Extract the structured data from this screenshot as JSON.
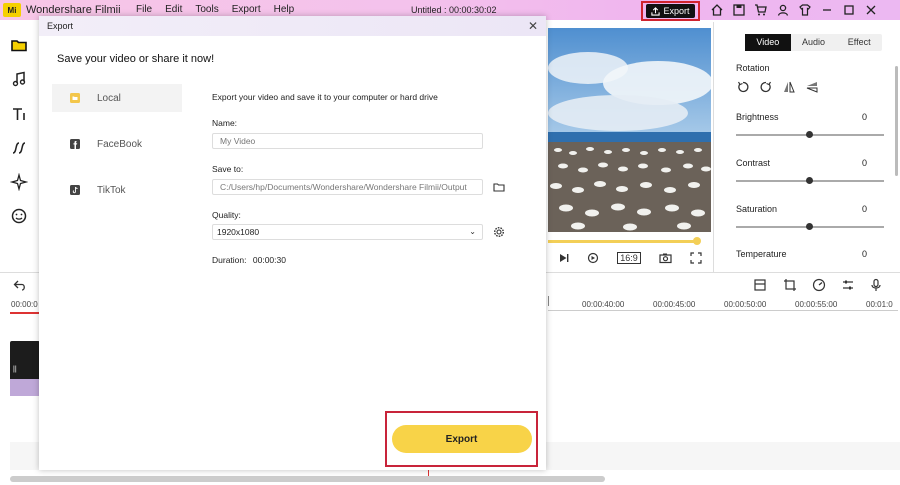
{
  "app": {
    "logo_text": "Mi",
    "name": "Wondershare Filmii",
    "menu": [
      "File",
      "Edit",
      "Tools",
      "Export",
      "Help"
    ],
    "doc_title": "Untitled :  00:00:30:02",
    "export_button": "Export"
  },
  "dialog": {
    "title": "Export",
    "heading": "Save your video or share it now!",
    "nav": [
      {
        "label": "Local",
        "icon": "local-folder-icon"
      },
      {
        "label": "FaceBook",
        "icon": "facebook-icon"
      },
      {
        "label": "TikTok",
        "icon": "tiktok-icon"
      }
    ],
    "description": "Export your video and save it to your computer or hard drive",
    "name_label": "Name:",
    "name_placeholder": "My Video",
    "save_label": "Save to:",
    "save_path": "C:/Users/hp/Documents/Wondershare/Wondershare Filmii/Output",
    "quality_label": "Quality:",
    "quality_value": "1920x1080",
    "duration_label": "Duration:",
    "duration_value": "00:00:30",
    "export_button": "Export"
  },
  "right_panel": {
    "tabs": [
      "Video",
      "Audio",
      "Effect"
    ],
    "active_tab": "Video",
    "rotation_label": "Rotation",
    "adjustments": [
      {
        "label": "Brightness",
        "value": "0"
      },
      {
        "label": "Contrast",
        "value": "0"
      },
      {
        "label": "Saturation",
        "value": "0"
      },
      {
        "label": "Temperature",
        "value": "0"
      }
    ]
  },
  "preview": {
    "aspect_label": "16:9",
    "progress": 1.0
  },
  "timeline": {
    "ticks": [
      "00:00:0",
      "00:00:40:00",
      "00:00:45:00",
      "00:00:50:00",
      "00:00:55:00",
      "00:01:0"
    ]
  }
}
